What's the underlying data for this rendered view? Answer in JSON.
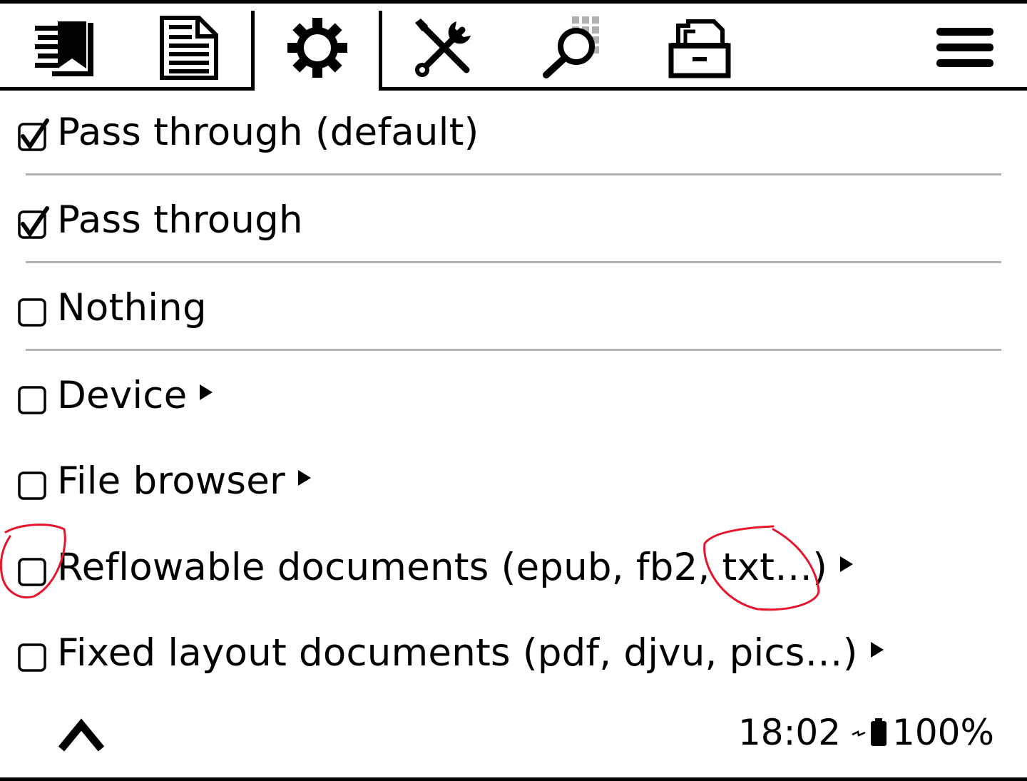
{
  "tabs": [
    {
      "id": "navigation",
      "icon": "book-list-icon",
      "active": false
    },
    {
      "id": "document",
      "icon": "document-icon",
      "active": false
    },
    {
      "id": "settings",
      "icon": "gear-icon",
      "active": true
    },
    {
      "id": "tools",
      "icon": "tools-icon",
      "active": false
    },
    {
      "id": "search",
      "icon": "search-icon",
      "active": false
    },
    {
      "id": "filemanager",
      "icon": "filing-cabinet-icon",
      "active": false
    },
    {
      "id": "main-menu",
      "icon": "hamburger-menu-icon",
      "active": false
    }
  ],
  "menu": {
    "items": [
      {
        "label": "Pass through (default)",
        "checked": true,
        "has_submenu": false
      },
      {
        "label": "Pass through",
        "checked": true,
        "has_submenu": false
      },
      {
        "label": "Nothing",
        "checked": false,
        "has_submenu": false
      },
      {
        "label": "Device",
        "checked": false,
        "has_submenu": true
      },
      {
        "label": "File browser",
        "checked": false,
        "has_submenu": true
      },
      {
        "label": "Reflowable documents (epub, fb2, txt…)",
        "checked": false,
        "has_submenu": true
      },
      {
        "label": "Fixed layout documents (pdf, djvu, pics…)",
        "checked": false,
        "has_submenu": true
      }
    ]
  },
  "footer": {
    "up_icon": "chevron-up-icon",
    "time": "18:02",
    "battery_percent": "100%",
    "charging_icon": "charging-bolt-icon",
    "battery_icon": "battery-icon"
  },
  "colors": {
    "separator": "#b3b3b3",
    "annotation": "#e8142b"
  }
}
